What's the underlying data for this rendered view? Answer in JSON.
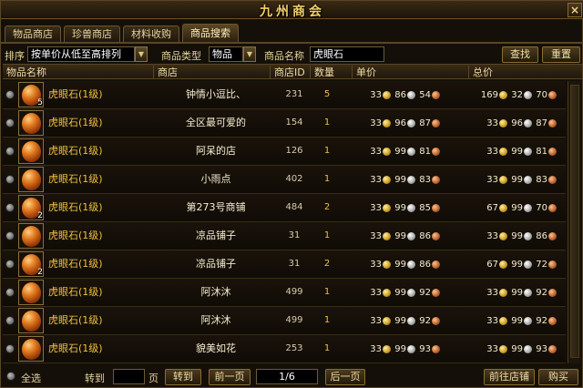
{
  "window": {
    "title": "九州商会",
    "close_label": "×"
  },
  "tabs": [
    {
      "label": "物品商店"
    },
    {
      "label": "珍兽商店"
    },
    {
      "label": "材料收购"
    },
    {
      "label": "商品搜索"
    }
  ],
  "filters": {
    "sort_label": "排序",
    "sort_value": "按单价从低至高排列",
    "type_label": "商品类型",
    "type_value": "物品",
    "name_label": "商品名称",
    "name_value": "虎眼石",
    "search_button": "查找",
    "reset_button": "重置"
  },
  "table": {
    "headers": {
      "item": "物品名称",
      "shop": "商店",
      "shop_id": "商店ID",
      "qty": "数量",
      "unit_price": "单价",
      "total_price": "总价"
    },
    "rows": [
      {
        "name": "虎眼石(1级)",
        "shop": "钟情小逗比、",
        "id": "231",
        "qty": "5",
        "badge": "5",
        "unit": [
          "33",
          "86",
          "54"
        ],
        "total": [
          "169",
          "32",
          "70"
        ]
      },
      {
        "name": "虎眼石(1级)",
        "shop": "全区最可爱的",
        "id": "154",
        "qty": "1",
        "badge": "",
        "unit": [
          "33",
          "96",
          "87"
        ],
        "total": [
          "33",
          "96",
          "87"
        ]
      },
      {
        "name": "虎眼石(1级)",
        "shop": "阿呆的店",
        "id": "126",
        "qty": "1",
        "badge": "",
        "unit": [
          "33",
          "99",
          "81"
        ],
        "total": [
          "33",
          "99",
          "81"
        ]
      },
      {
        "name": "虎眼石(1级)",
        "shop": "小雨点",
        "id": "402",
        "qty": "1",
        "badge": "",
        "unit": [
          "33",
          "99",
          "83"
        ],
        "total": [
          "33",
          "99",
          "83"
        ]
      },
      {
        "name": "虎眼石(1级)",
        "shop": "第273号商铺",
        "id": "484",
        "qty": "2",
        "badge": "2",
        "unit": [
          "33",
          "99",
          "85"
        ],
        "total": [
          "67",
          "99",
          "70"
        ]
      },
      {
        "name": "虎眼石(1级)",
        "shop": "凉品铺子",
        "id": "31",
        "qty": "1",
        "badge": "",
        "unit": [
          "33",
          "99",
          "86"
        ],
        "total": [
          "33",
          "99",
          "86"
        ]
      },
      {
        "name": "虎眼石(1级)",
        "shop": "凉品铺子",
        "id": "31",
        "qty": "2",
        "badge": "2",
        "unit": [
          "33",
          "99",
          "86"
        ],
        "total": [
          "67",
          "99",
          "72"
        ]
      },
      {
        "name": "虎眼石(1级)",
        "shop": "阿沐沐",
        "id": "499",
        "qty": "1",
        "badge": "",
        "unit": [
          "33",
          "99",
          "92"
        ],
        "total": [
          "33",
          "99",
          "92"
        ]
      },
      {
        "name": "虎眼石(1级)",
        "shop": "阿沐沐",
        "id": "499",
        "qty": "1",
        "badge": "",
        "unit": [
          "33",
          "99",
          "92"
        ],
        "total": [
          "33",
          "99",
          "92"
        ]
      },
      {
        "name": "虎眼石(1级)",
        "shop": "貌美如花",
        "id": "253",
        "qty": "1",
        "badge": "",
        "unit": [
          "33",
          "99",
          "93"
        ],
        "total": [
          "33",
          "99",
          "93"
        ]
      }
    ]
  },
  "footer": {
    "select_all": "全选",
    "goto_label": "转到",
    "goto_value": "",
    "page_unit": "页",
    "goto_button": "转到",
    "prev_button": "前一页",
    "page_indicator": "1/6",
    "next_button": "后一页",
    "visit_shop_button": "前往店铺",
    "buy_button": "购买"
  }
}
